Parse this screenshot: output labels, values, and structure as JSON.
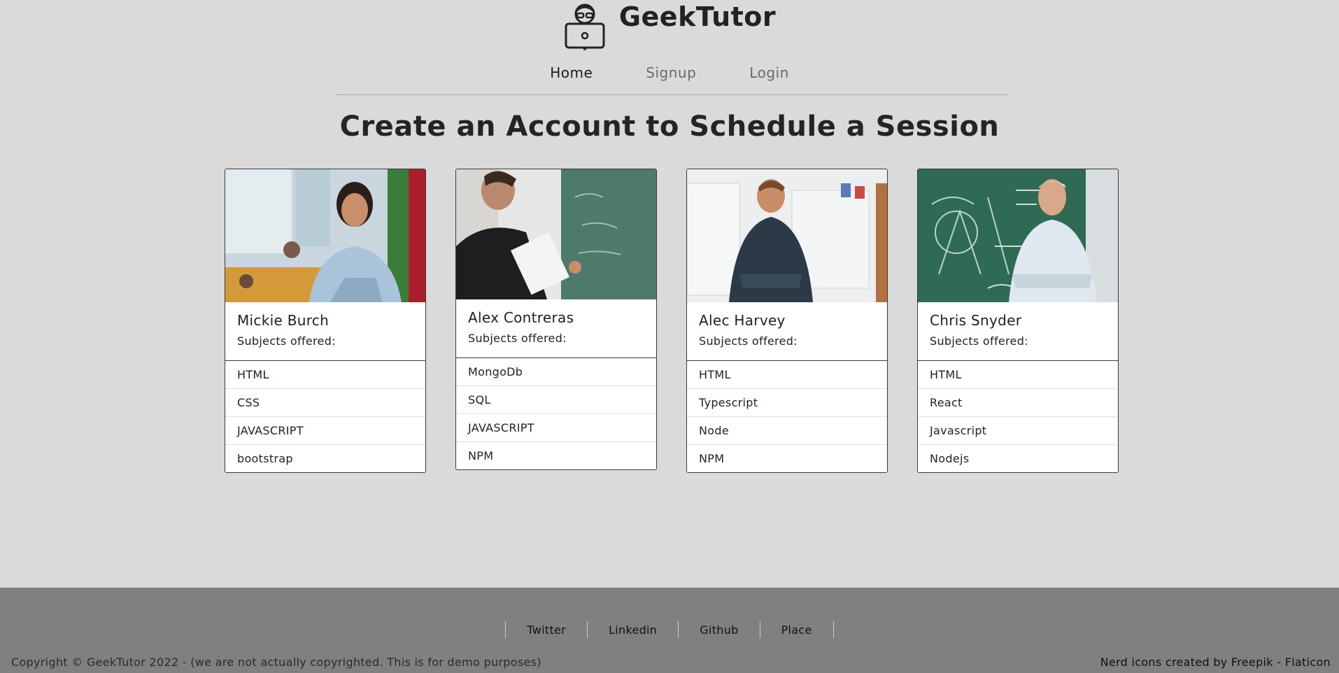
{
  "brand": {
    "title": "GeekTutor",
    "logo_icon": "nerd-laptop-icon"
  },
  "nav": {
    "items": [
      {
        "label": "Home",
        "active": true
      },
      {
        "label": "Signup",
        "active": false
      },
      {
        "label": "Login",
        "active": false
      }
    ]
  },
  "headline": "Create an Account to Schedule a Session",
  "tutors": [
    {
      "name": "Mickie Burch",
      "subjects_label": "Subjects offered:",
      "subjects": [
        "HTML",
        "CSS",
        "JAVASCRIPT",
        "bootstrap"
      ]
    },
    {
      "name": "Alex Contreras",
      "subjects_label": "Subjects offered:",
      "subjects": [
        "MongoDb",
        "SQL",
        "JAVASCRIPT",
        "NPM"
      ]
    },
    {
      "name": "Alec Harvey",
      "subjects_label": "Subjects offered:",
      "subjects": [
        "HTML",
        "Typescript",
        "Node",
        "NPM"
      ]
    },
    {
      "name": "Chris Snyder",
      "subjects_label": "Subjects offered:",
      "subjects": [
        "HTML",
        "React",
        "Javascript",
        "Nodejs"
      ]
    }
  ],
  "footer": {
    "links": [
      "Twitter",
      "Linkedin",
      "Github",
      "Place"
    ],
    "copyright": "Copyright © GeekTutor 2022 - (we are not actually copyrighted. This is for demo purposes)",
    "credits": "Nerd icons created by Freepik - Flaticon"
  },
  "colors": {
    "background": "#dadada",
    "footer": "#808080",
    "card": "#ffffff",
    "text": "#222222"
  }
}
